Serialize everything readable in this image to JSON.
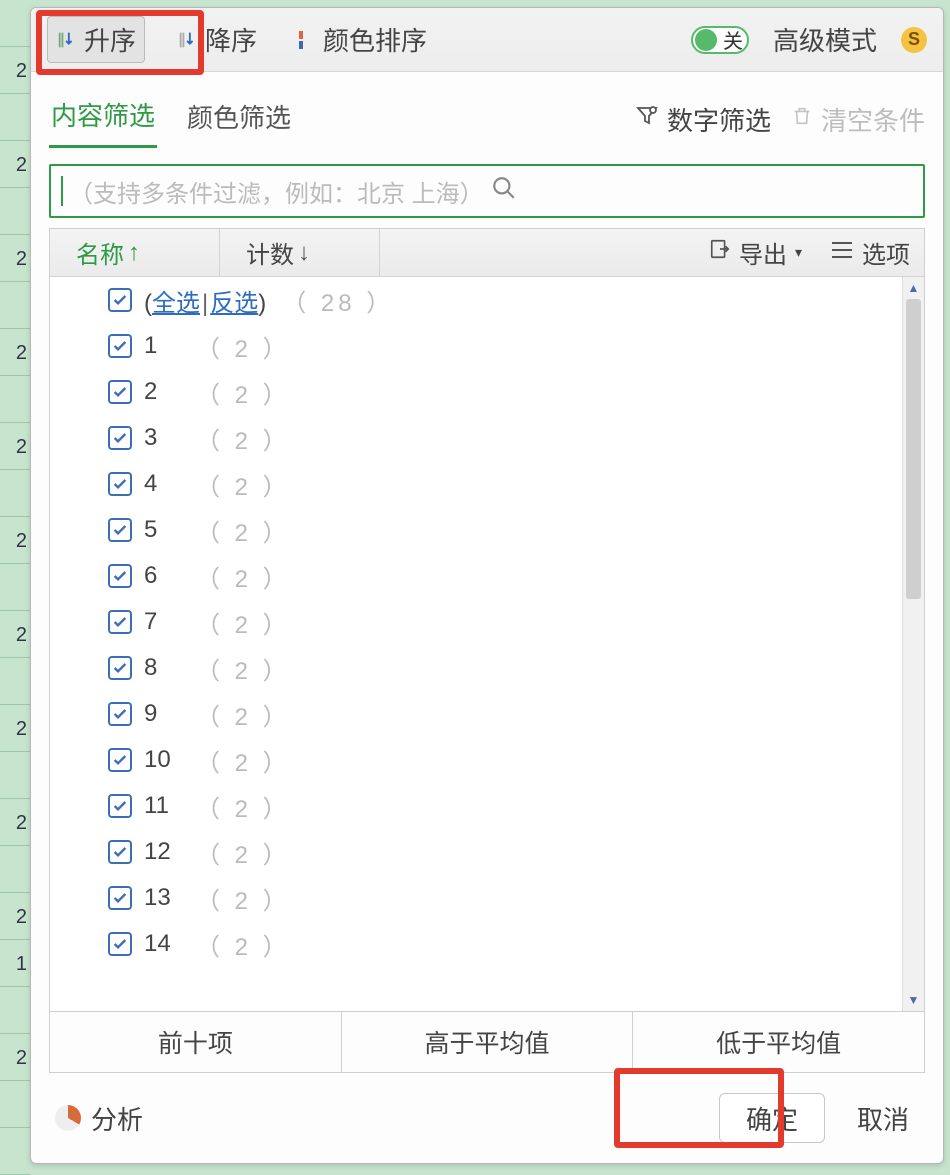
{
  "toolbar": {
    "asc": "升序",
    "desc": "降序",
    "colorSort": "颜色排序",
    "switchLabel": "关",
    "advanced": "高级模式"
  },
  "tabs": {
    "content": "内容筛选",
    "color": "颜色筛选",
    "numberFilter": "数字筛选",
    "clear": "清空条件"
  },
  "search": {
    "placeholder": "（支持多条件过滤，例如：北京  上海）"
  },
  "listHead": {
    "name": "名称",
    "count": "计数",
    "export": "导出",
    "options": "选项"
  },
  "all": {
    "selectAll": "全选",
    "invert": "反选",
    "total": "（ 28 ）"
  },
  "rows": [
    {
      "v": "1",
      "c": "（ 2 ）"
    },
    {
      "v": "2",
      "c": "（ 2 ）"
    },
    {
      "v": "3",
      "c": "（ 2 ）"
    },
    {
      "v": "4",
      "c": "（ 2 ）"
    },
    {
      "v": "5",
      "c": "（ 2 ）"
    },
    {
      "v": "6",
      "c": "（ 2 ）"
    },
    {
      "v": "7",
      "c": "（ 2 ）"
    },
    {
      "v": "8",
      "c": "（ 2 ）"
    },
    {
      "v": "9",
      "c": "（ 2 ）"
    },
    {
      "v": "10",
      "c": "（ 2 ）"
    },
    {
      "v": "11",
      "c": "（ 2 ）"
    },
    {
      "v": "12",
      "c": "（ 2 ）"
    },
    {
      "v": "13",
      "c": "（ 2 ）"
    },
    {
      "v": "14",
      "c": "（ 2 ）"
    }
  ],
  "quick": {
    "top10": "前十项",
    "above": "高于平均值",
    "below": "低于平均值"
  },
  "footer": {
    "analyze": "分析",
    "ok": "确定",
    "cancel": "取消"
  },
  "gutter": [
    "",
    "2",
    "",
    "2",
    "",
    "2",
    "",
    "2",
    "",
    "2",
    "",
    "2",
    "",
    "2",
    "",
    "2",
    "",
    "2",
    "",
    "2",
    "1",
    "",
    "2",
    "",
    ""
  ]
}
